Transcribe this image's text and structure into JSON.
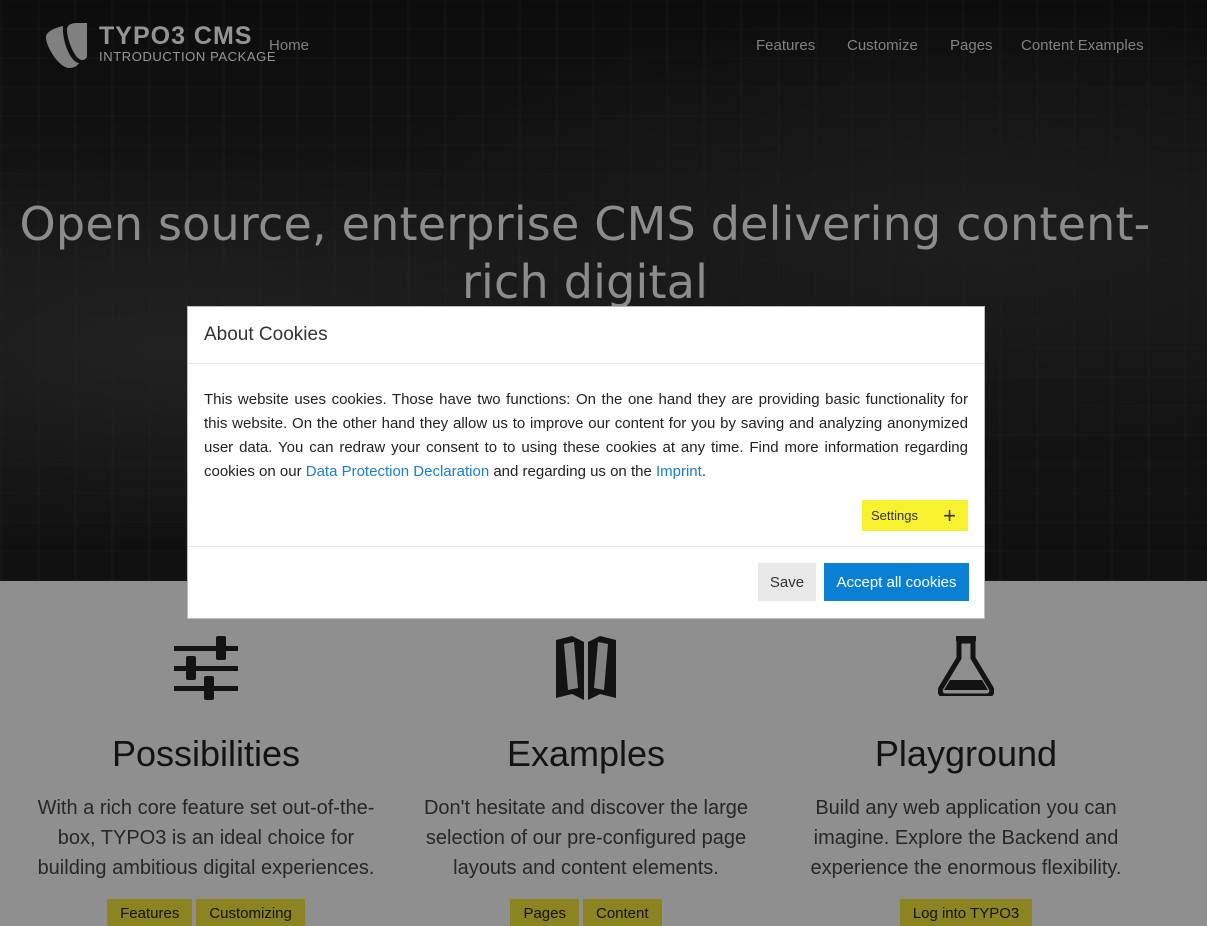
{
  "logo": {
    "title": "TYPO3 CMS",
    "subtitle": "INTRODUCTION PACKAGE",
    "icon": "typo3-logo-icon"
  },
  "nav": {
    "home": "Home",
    "items": [
      "Features",
      "Customize",
      "Pages",
      "Content Examples"
    ]
  },
  "hero": {
    "title": "Open source, enterprise CMS delivering content-rich digital"
  },
  "features": [
    {
      "icon": "sliders-icon",
      "title": "Possibilities",
      "text": "With a rich core feature set out-of-the-box, TYPO3 is an ideal choice for building ambitious digital experiences.",
      "buttons": [
        "Features",
        "Customizing"
      ]
    },
    {
      "icon": "book-icon",
      "title": "Examples",
      "text": "Don't hesitate and discover the large selection of our pre-configured page layouts and content elements.",
      "buttons": [
        "Pages",
        "Content"
      ]
    },
    {
      "icon": "flask-icon",
      "title": "Playground",
      "text": "Build any web application you can imagine. Explore the Backend and experience the enormous flexibility.",
      "buttons": [
        "Log into TYPO3"
      ]
    }
  ],
  "cookie": {
    "title": "About Cookies",
    "text_before": "This website uses cookies. Those have two functions: On the one hand they are providing basic functionality for this website. On the other hand they allow us to improve our content for you by saving and analyzing anonymized user data. You can redraw your consent to to using these cookies at any time. Find more information regarding cookies on our ",
    "link_privacy": "Data Protection Declaration",
    "text_middle": " and regarding us on the ",
    "link_imprint": "Imprint",
    "text_after": ".",
    "settings_label": "Settings",
    "settings_icon": "plus-icon",
    "save_label": "Save",
    "accept_label": "Accept all cookies"
  },
  "colors": {
    "accent_yellow": "#f1e33a",
    "primary_blue": "#0a80d4",
    "link_blue": "#1c7ec8"
  }
}
